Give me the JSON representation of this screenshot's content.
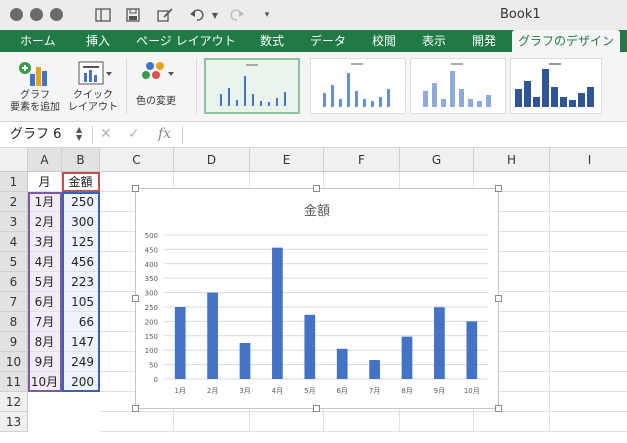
{
  "window": {
    "title": "Book1"
  },
  "ribbon_tabs": [
    "ホーム",
    "挿入",
    "ページ レイアウト",
    "数式",
    "データ",
    "校閲",
    "表示",
    "開発",
    "グラフのデザイン"
  ],
  "ribbon": {
    "add_element_label_1": "グラフ",
    "add_element_label_2": "要素を追加",
    "quick_layout_label_1": "クイック",
    "quick_layout_label_2": "レイアウト",
    "change_colors_label": "色の変更"
  },
  "formula_bar": {
    "name_box": "グラフ 6",
    "fx_symbol": "fx",
    "cancel_symbol": "✕",
    "enter_symbol": "✓"
  },
  "columns": [
    "A",
    "B",
    "C",
    "D",
    "E",
    "F",
    "G",
    "H",
    "I"
  ],
  "rows": [
    "1",
    "2",
    "3",
    "4",
    "5",
    "6",
    "7",
    "8",
    "9",
    "10",
    "11",
    "12",
    "13"
  ],
  "table": {
    "headers": [
      "月",
      "金額"
    ],
    "months": [
      "1月",
      "2月",
      "3月",
      "4月",
      "5月",
      "6月",
      "7月",
      "8月",
      "9月",
      "10月"
    ],
    "amounts": [
      "250",
      "300",
      "125",
      "456",
      "223",
      "105",
      "66",
      "147",
      "249",
      "200"
    ]
  },
  "colors": {
    "bar": "#4472c4",
    "ribbon_green": "#1f7a45"
  },
  "chart_data": {
    "type": "bar",
    "title": "金額",
    "categories": [
      "1月",
      "2月",
      "3月",
      "4月",
      "5月",
      "6月",
      "7月",
      "8月",
      "9月",
      "10月"
    ],
    "values": [
      250,
      300,
      125,
      456,
      223,
      105,
      66,
      147,
      249,
      200
    ],
    "ylim": [
      0,
      500
    ],
    "yticks": [
      "0",
      "50",
      "100",
      "150",
      "200",
      "250",
      "300",
      "350",
      "400",
      "450",
      "500"
    ],
    "grid": true,
    "legend": "none"
  }
}
